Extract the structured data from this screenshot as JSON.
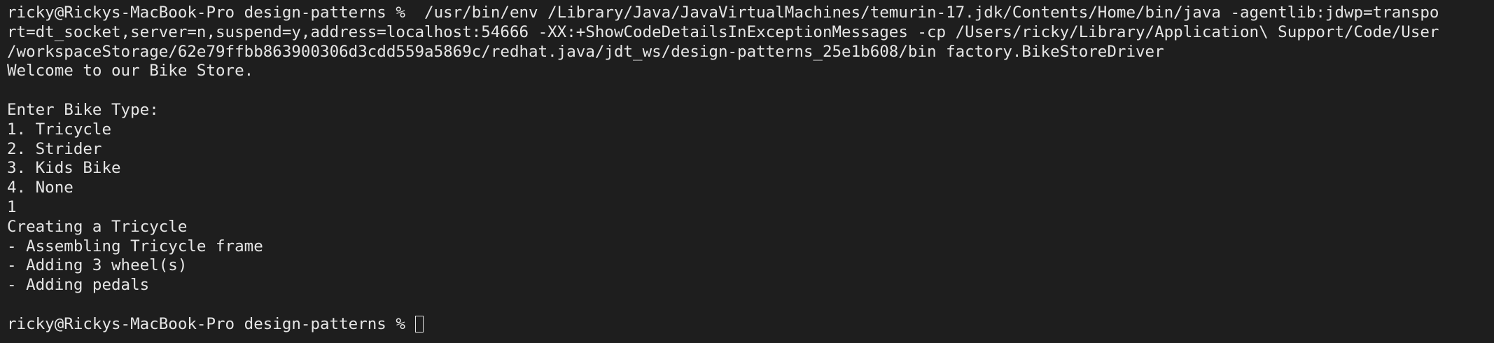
{
  "terminal": {
    "colors": {
      "background": "#1e1e1e",
      "foreground": "#e6e6e6"
    },
    "lines": [
      "ricky@Rickys-MacBook-Pro design-patterns %  /usr/bin/env /Library/Java/JavaVirtualMachines/temurin-17.jdk/Contents/Home/bin/java -agentlib:jdwp=transpo",
      "rt=dt_socket,server=n,suspend=y,address=localhost:54666 -XX:+ShowCodeDetailsInExceptionMessages -cp /Users/ricky/Library/Application\\ Support/Code/User",
      "/workspaceStorage/62e79ffbb863900306d3cdd559a5869c/redhat.java/jdt_ws/design-patterns_25e1b608/bin factory.BikeStoreDriver",
      "Welcome to our Bike Store.",
      "",
      "Enter Bike Type:",
      "1. Tricycle",
      "2. Strider",
      "3. Kids Bike",
      "4. None",
      "1",
      "Creating a Tricycle",
      "- Assembling Tricycle frame",
      "- Adding 3 wheel(s)",
      "- Adding pedals",
      ""
    ],
    "prompt": "ricky@Rickys-MacBook-Pro design-patterns % "
  }
}
